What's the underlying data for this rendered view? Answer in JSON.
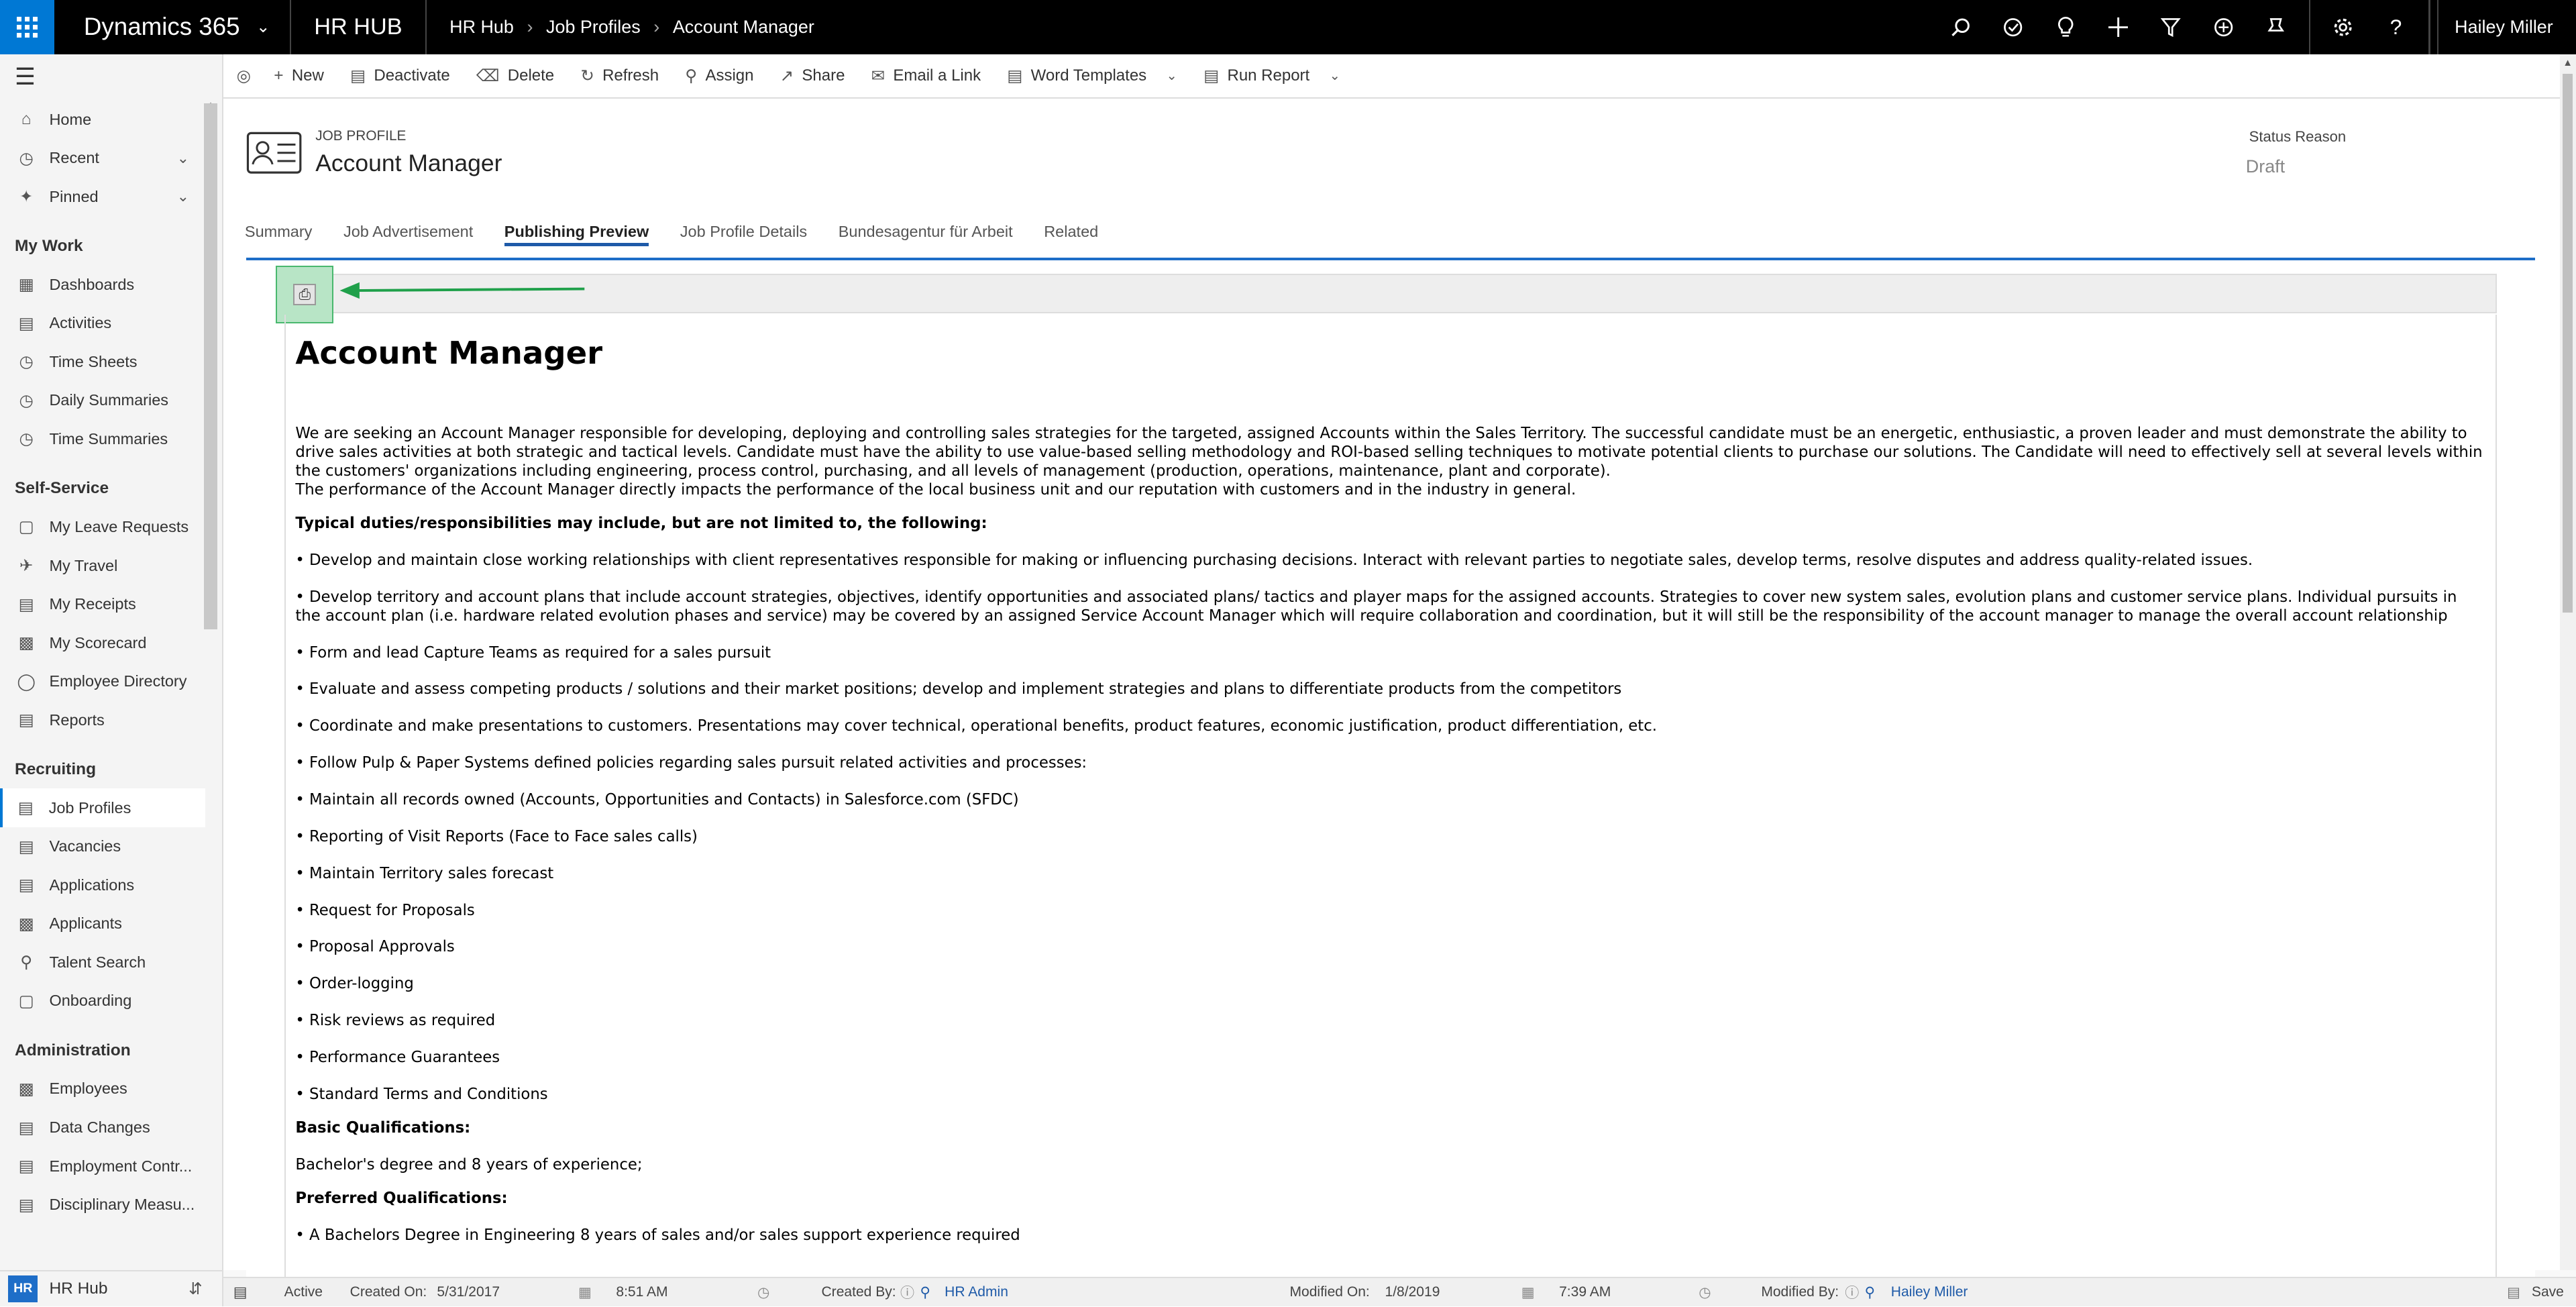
{
  "topbar": {
    "brand": "Dynamics 365",
    "app_title": "HR HUB",
    "breadcrumb": [
      "HR Hub",
      "Job Profiles",
      "Account Manager"
    ],
    "user": "Hailey Miller",
    "icons": [
      "search-icon",
      "task-icon",
      "lightbulb-icon",
      "plus-icon",
      "filter-icon",
      "add-circle-icon",
      "bookmark-icon",
      "gear-icon",
      "help-icon"
    ]
  },
  "sidebar": {
    "top_items": [
      {
        "label": "Home",
        "icon": "home-icon"
      },
      {
        "label": "Recent",
        "icon": "clock-icon"
      },
      {
        "label": "Pinned",
        "icon": "pin-icon"
      }
    ],
    "groups": [
      {
        "title": "My Work",
        "items": [
          "Dashboards",
          "Activities",
          "Time Sheets",
          "Daily Summaries",
          "Time Summaries"
        ]
      },
      {
        "title": "Self-Service",
        "items": [
          "My Leave Requests",
          "My Travel",
          "My Receipts",
          "My Scorecard",
          "Employee Directory",
          "Reports"
        ]
      },
      {
        "title": "Recruiting",
        "items": [
          "Job Profiles",
          "Vacancies",
          "Applications",
          "Applicants",
          "Talent Search",
          "Onboarding"
        ]
      },
      {
        "title": "Administration",
        "items": [
          "Employees",
          "Data Changes",
          "Employment Contr...",
          "Disciplinary Measu..."
        ]
      }
    ],
    "area_badge": "HR",
    "area_label": "HR Hub"
  },
  "commands": [
    "New",
    "Deactivate",
    "Delete",
    "Refresh",
    "Assign",
    "Share",
    "Email a Link",
    "Word Templates",
    "Run Report"
  ],
  "header": {
    "entity_type": "JOB PROFILE",
    "record_name": "Account Manager",
    "status_label": "Status Reason",
    "status_value": "Draft"
  },
  "tabs": [
    "Summary",
    "Job Advertisement",
    "Publishing Preview",
    "Job Profile Details",
    "Bundesagentur für Arbeit",
    "Related"
  ],
  "active_tab": "Publishing Preview",
  "preview": {
    "title": "Account Manager",
    "intro": "We are seeking an Account Manager responsible for developing, deploying and controlling sales strategies for the targeted, assigned Accounts within the Sales Territory. The successful candidate must be an energetic, enthusiastic, a proven leader and must demonstrate the ability to drive sales activities at both strategic and tactical levels. Candidate must have the ability to use value-based selling methodology and ROI-based selling techniques to motivate potential clients to purchase our solutions. The Candidate will need to effectively sell at several levels within the customers' organizations including engineering, process control, purchasing, and all levels of management (production, operations, maintenance, plant and corporate).",
    "intro2": "The performance of the Account Manager directly impacts the performance of the local business unit and our reputation with customers and in the industry in general.",
    "duties_heading": "Typical duties/responsibilities may include, but are not limited to, the following:",
    "duties": [
      "• Develop and maintain close working relationships with client representatives responsible for making or influencing purchasing decisions. Interact with relevant parties to negotiate sales, develop terms, resolve disputes and address quality-related issues.",
      "• Develop territory and account plans that include account strategies, objectives, identify opportunities and associated plans/ tactics and player maps for the assigned accounts. Strategies to cover new system sales, evolution plans and customer service plans. Individual pursuits in the account plan (i.e. hardware related evolution phases and service) may be covered by an assigned Service Account Manager which will require collaboration and coordination, but it will still be the responsibility of the account manager to manage the overall account relationship",
      "• Form and lead Capture Teams as required for a sales pursuit",
      "• Evaluate and assess competing products / solutions and their market positions; develop and implement strategies and plans to differentiate products from the competitors",
      "• Coordinate and make presentations to customers. Presentations may cover technical, operational benefits, product features, economic justification, product differentiation, etc.",
      "• Follow Pulp & Paper Systems defined policies regarding sales pursuit related activities and processes:",
      "• Maintain all records owned (Accounts, Opportunities and Contacts) in Salesforce.com (SFDC)",
      "• Reporting of Visit Reports (Face to Face sales calls)",
      "• Maintain Territory sales forecast",
      "• Request for Proposals",
      "• Proposal Approvals",
      "• Order-logging",
      "• Risk reviews as required",
      "• Performance Guarantees",
      "• Standard Terms and Conditions"
    ],
    "basic_heading": "Basic Qualifications:",
    "basic_text": "Bachelor's degree and 8 years of experience;",
    "preferred_heading": "Preferred Qualifications:",
    "preferred_first": "• A Bachelors Degree in Engineering 8 years of sales and/or sales support experience required"
  },
  "statusbar": {
    "state": "Active",
    "created_on_label": "Created On:",
    "created_on_date": "5/31/2017",
    "created_on_time": "8:51 AM",
    "created_by_label": "Created By:",
    "created_by": "HR Admin",
    "modified_on_label": "Modified On:",
    "modified_on_date": "1/8/2019",
    "modified_on_time": "7:39 AM",
    "modified_by_label": "Modified By:",
    "modified_by": "Hailey Miller",
    "save_label": "Save"
  }
}
